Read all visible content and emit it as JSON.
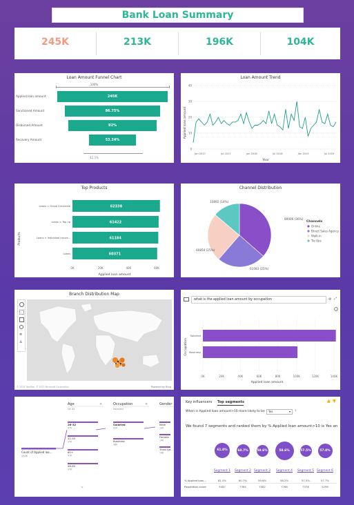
{
  "report_title": "Bank Loan Summary",
  "kpis": [
    {
      "value": "245K",
      "color": "#f39a83"
    },
    {
      "value": "213K",
      "color": "#2fb597"
    },
    {
      "value": "196K",
      "color": "#2fb597"
    },
    {
      "value": "104K",
      "color": "#2fb597"
    }
  ],
  "funnel": {
    "title": "Loan Amount Funnel Chart",
    "top_pct": "100%",
    "bottom_pct": "42.5%",
    "stages": [
      {
        "label": "Applied loan amount",
        "value": "245K",
        "fraction": 1.0
      },
      {
        "label": "Sanctioned Amount",
        "value": "86.75%",
        "fraction": 0.8675
      },
      {
        "label": "Disbursed Amount",
        "value": "92%",
        "fraction": 0.8
      },
      {
        "label": "Recovery Amount",
        "value": "53.24%",
        "fraction": 0.425
      }
    ]
  },
  "trend": {
    "title": "Loan Amount Trend",
    "ylabel": "Applied loan amount",
    "xlabel": "Year",
    "yticks": [
      "40",
      "30",
      "20",
      "10",
      "0"
    ],
    "xticks": [
      "Jan 2017",
      "Jul 2017",
      "Jan 2018",
      "Jul 2018",
      "Jan 2019",
      "Jul 2019"
    ],
    "values": [
      4,
      17,
      19,
      17,
      15,
      17,
      22,
      15,
      17,
      20,
      16,
      18,
      16,
      15,
      17,
      17,
      18,
      22,
      16,
      23,
      17,
      13,
      15,
      15,
      16,
      18,
      16,
      24,
      16,
      22,
      15,
      14,
      12,
      25,
      13,
      22,
      18,
      30,
      14,
      13,
      20,
      8,
      13,
      15,
      17,
      25,
      17,
      16,
      22,
      15,
      14,
      17
    ]
  },
  "top_products": {
    "title": "Top Products",
    "ylabel": "Products",
    "xlabel": "Applied loan amount",
    "xticks": [
      "0K",
      "20K",
      "40K",
      "60K"
    ],
    "bars": [
      {
        "label": "Loans > Group Insurance",
        "value": "62338",
        "num": 62338
      },
      {
        "label": "Loans > Top up",
        "value": "61422",
        "num": 61422
      },
      {
        "label": "Loans > Individual Insura...",
        "value": "61184",
        "num": 61184
      },
      {
        "label": "Loans",
        "value": "60371",
        "num": 60371
      }
    ]
  },
  "chart_data": [
    {
      "type": "pie",
      "title": "Channel Distribution",
      "legend_title": "Channels",
      "slices": [
        {
          "name": "Online",
          "value": 89406,
          "label": "89406 (36%)",
          "color": "#8a4fc8"
        },
        {
          "name": "Direct Sales Agency",
          "value": 61083,
          "label": "61083 (25%)",
          "color": "#8a7ad8"
        },
        {
          "name": "Walk-in",
          "value": 60854,
          "label": "60854 (25%)",
          "color": "#f8cfc3"
        },
        {
          "name": "Tie Ups",
          "value": 33892,
          "label": "33892 (14%)",
          "color": "#5bc9c2"
        }
      ]
    },
    {
      "type": "bar",
      "title": "what is the applied loan amount by occupation",
      "ylabel": "Occupation",
      "xlabel": "Applied loan amount",
      "categories": [
        "Salaried",
        "Business"
      ],
      "values": [
        142000,
        101000
      ],
      "xticks": [
        "0K",
        "20K",
        "40K",
        "60K",
        "80K",
        "100K",
        "120K",
        "140K"
      ]
    }
  ],
  "map": {
    "title": "Branch Distribution Map",
    "attribution_left": "© 2023 TomTom, © 2023 Microsoft Corporation",
    "attribution_right": "Powered by Bing"
  },
  "qna": {
    "query": "what is the applied loan amount by occupation"
  },
  "decomp": {
    "root_label": "Count of Applied loa...",
    "root_value": "252K",
    "columns": [
      {
        "header": "Age",
        "sub": "26-32",
        "items": [
          {
            "label": "26-32",
            "value": "47K"
          },
          {
            "label": "42-55",
            "value": "47K"
          },
          {
            "label": "60+",
            "value": "47K"
          },
          {
            "label": "56-60",
            "value": "47K"
          }
        ]
      },
      {
        "header": "Occupation",
        "sub": "Salaried",
        "items": [
          {
            "label": "Salaried",
            "value": "41K"
          },
          {
            "label": "Business",
            "value": "36K"
          }
        ]
      },
      {
        "header": "Gender",
        "sub": "",
        "items": [
          {
            "label": "Male",
            "value": "19K"
          },
          {
            "label": "Female",
            "value": "14K"
          },
          {
            "label": "Third Ge...",
            "value": "14K"
          }
        ]
      }
    ]
  },
  "influencers": {
    "tab1": "Key influencers",
    "tab2": "Top segments",
    "question": "When is Applied loan amount>10 more likely to be",
    "select": "Yes",
    "help": "?",
    "summary": "We found 7 segments and ranked them by % Applied loan amount>10 is Yes and ...",
    "row1_label": "% Applied loan...",
    "row2_label": "Population count",
    "segments": [
      {
        "name": "Segment 1",
        "circle": "61.0%",
        "pct": "61.0%",
        "pop": "5467",
        "size": 22
      },
      {
        "name": "Segment 2",
        "circle": "60.7%",
        "pct": "60.7%",
        "pop": "7364",
        "size": 19
      },
      {
        "name": "Segment 3",
        "circle": "59.6%",
        "pct": "59.6%",
        "pop": "7082",
        "size": 17
      },
      {
        "name": "Segment 4",
        "circle": "58.6%",
        "pct": "58.2%",
        "pop": "7768",
        "size": 27
      },
      {
        "name": "Segment 5",
        "circle": "57.5%",
        "pct": "57.5%",
        "pop": "7378",
        "size": 17
      },
      {
        "name": "Segment 6",
        "circle": "57.0%",
        "pct": "57.7%",
        "pop": "5299",
        "size": 21
      }
    ]
  }
}
